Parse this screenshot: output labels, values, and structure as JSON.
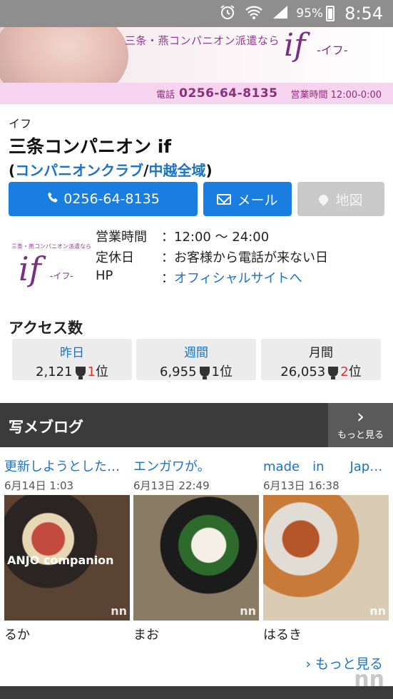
{
  "status_bar": {
    "battery_pct": "95%",
    "time": "8:54",
    "icons": [
      "alarm-icon",
      "wifi-icon",
      "signal-icon",
      "battery-icon"
    ]
  },
  "banner": {
    "tagline": "三条・燕コンパニオン派遣なら",
    "logo_main": "if",
    "logo_kana": "-イフ-",
    "phone_label": "電話",
    "phone": "0256-64-8135",
    "hours_text": "営業時間 12:00-0:00"
  },
  "shop": {
    "kana": "イフ",
    "name": "三条コンパニオン if",
    "open_paren": "(",
    "category_link": "コンパニオンクラブ",
    "slash": "/",
    "area_link": "中越全域",
    "close_paren": ")"
  },
  "actions": {
    "tel_label": "0256-64-8135",
    "mail_label": "メール",
    "map_label": "地図"
  },
  "info": {
    "logo_tagline": "三条・燕コンパニオン派遣なら",
    "logo_main": "if",
    "logo_kana": "-イフ-",
    "rows": [
      {
        "key": "営業時間",
        "value": "：12:00 〜 24:00"
      },
      {
        "key": "定休日",
        "value": "：お客様から電話が来ない日"
      },
      {
        "key": "HP",
        "colon": "：",
        "value": "オフィシャルサイトへ"
      }
    ]
  },
  "access": {
    "title": "アクセス数",
    "cards": [
      {
        "period": "昨日",
        "count": "2,121",
        "rank": "1",
        "suffix": "位"
      },
      {
        "period": "週間",
        "count": "6,955",
        "rank": "1",
        "suffix": "位"
      },
      {
        "period": "月間",
        "count": "26,053",
        "rank": "2",
        "suffix": "位"
      }
    ]
  },
  "blog": {
    "title": "写メブログ",
    "more_label": "もっと見る",
    "posts": [
      {
        "title": "更新しようとした…",
        "date": "6月14日 1:03",
        "name": "るか",
        "caption": "ANJO companion"
      },
      {
        "title": "エンガワが。",
        "date": "6月13日 22:49",
        "name": "まお",
        "caption": ""
      },
      {
        "title": "made　in　　Jap…",
        "date": "6月13日 16:38",
        "name": "はるき",
        "caption": ""
      }
    ],
    "watermark": "nn",
    "more_link": "もっと見る"
  },
  "colors": {
    "primary_blue": "#1a7de0",
    "link_blue": "#1a73c8",
    "brand_purple": "#7a2f86",
    "rank_red": "#e03030"
  }
}
